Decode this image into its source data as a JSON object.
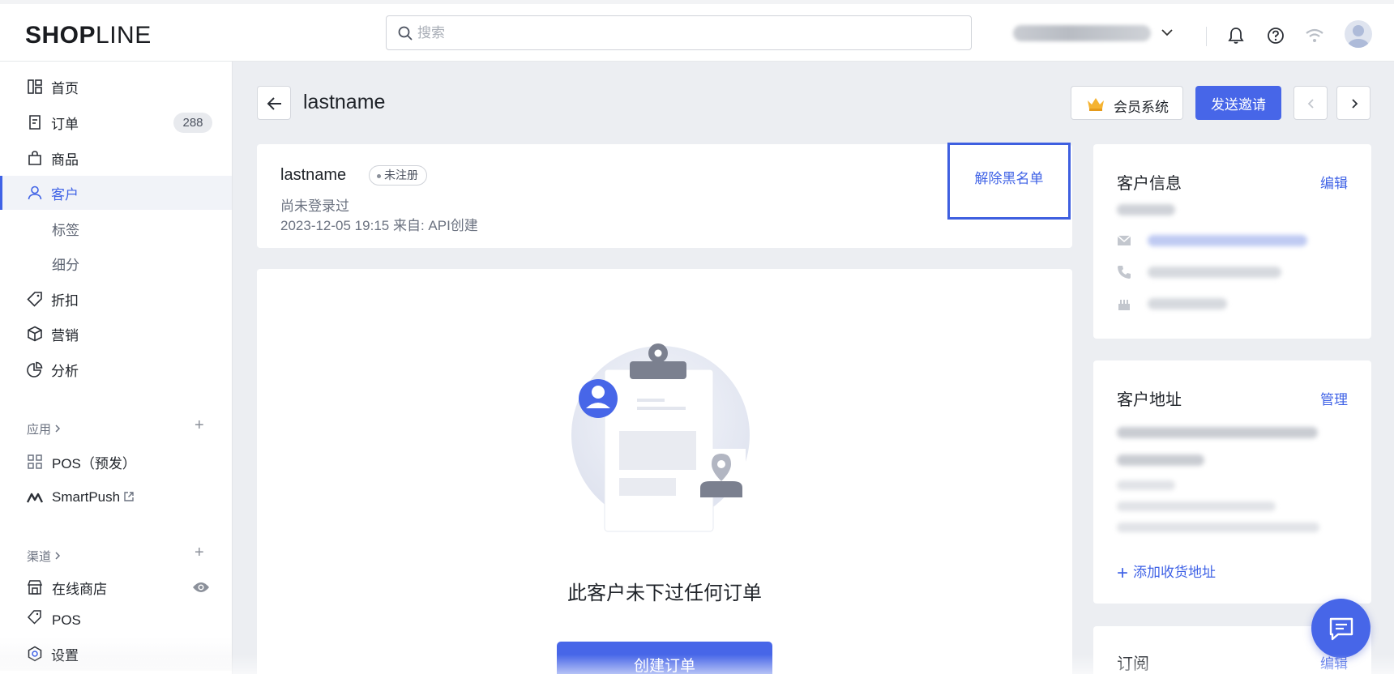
{
  "app": {
    "logo_bold": "SHOP",
    "logo_light": "LINE"
  },
  "topbar": {
    "search_placeholder": "搜索"
  },
  "sidebar": {
    "items": [
      {
        "label": "首页",
        "icon": "home-icon"
      },
      {
        "label": "订单",
        "icon": "order-icon",
        "badge": "288"
      },
      {
        "label": "商品",
        "icon": "bag-icon"
      },
      {
        "label": "客户",
        "icon": "user-icon",
        "active": true
      },
      {
        "label": "标签",
        "sub": true
      },
      {
        "label": "细分",
        "sub": true
      },
      {
        "label": "折扣",
        "icon": "tag-icon"
      },
      {
        "label": "营销",
        "icon": "cube-icon"
      },
      {
        "label": "分析",
        "icon": "pie-icon"
      }
    ],
    "apps_label": "应用",
    "apps": [
      {
        "label": "POS（预发）",
        "icon": "grid-icon"
      },
      {
        "label": "SmartPush",
        "icon": "smartpush-icon",
        "external": true
      }
    ],
    "channels_label": "渠道",
    "channels": [
      {
        "label": "在线商店",
        "icon": "store-icon"
      },
      {
        "label": "POS",
        "icon": "pos-icon"
      }
    ],
    "settings_label": "设置"
  },
  "header": {
    "title": "lastname",
    "member_button": "会员系统",
    "invite_button": "发送邀请"
  },
  "customer": {
    "name": "lastname",
    "status": "未注册",
    "login": "尚未登录过",
    "created": "2023-12-05 19:15  来自: API创建",
    "unblock": "解除黑名单"
  },
  "orders": {
    "empty_text": "此客户未下过任何订单",
    "create_button": "创建订单"
  },
  "info_card": {
    "title": "客户信息",
    "edit": "编辑"
  },
  "address_card": {
    "title": "客户地址",
    "manage": "管理",
    "add": "添加收货地址"
  },
  "subscription_card": {
    "title": "订阅",
    "edit": "编辑"
  },
  "colors": {
    "accent": "#4766e8",
    "link": "#3f62e6"
  }
}
